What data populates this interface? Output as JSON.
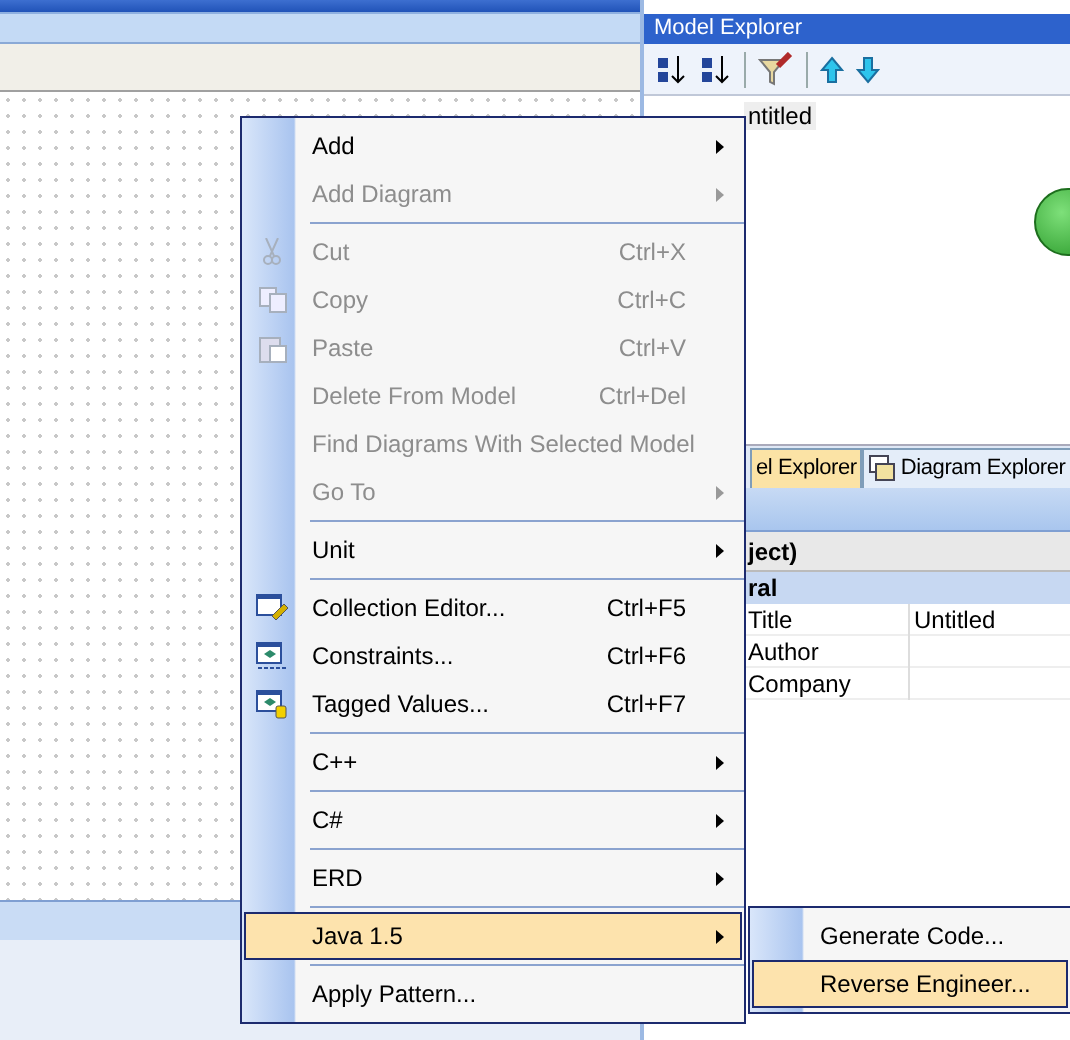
{
  "explorer": {
    "title": "Model Explorer",
    "tree_items": [
      {
        "label": "ntitled",
        "selected": true
      }
    ],
    "tabs": [
      {
        "label": "el Explorer",
        "selected": true
      },
      {
        "label": "Diagram Explorer",
        "selected": false
      }
    ]
  },
  "properties": {
    "object_header": "ject)",
    "group": "ral",
    "rows": [
      {
        "name": "Title",
        "value": "Untitled"
      },
      {
        "name": "Author",
        "value": ""
      },
      {
        "name": "Company",
        "value": ""
      }
    ]
  },
  "context_menu": {
    "items": [
      {
        "kind": "item",
        "label": "Add",
        "disabled": false,
        "submenu": true,
        "selected": false
      },
      {
        "kind": "item",
        "label": "Add Diagram",
        "disabled": true,
        "submenu": true,
        "selected": false
      },
      {
        "kind": "separator"
      },
      {
        "kind": "icon_item",
        "label": "Cut",
        "shortcut": "Ctrl+X",
        "disabled": true,
        "submenu": false,
        "selected": false
      },
      {
        "kind": "icon_item",
        "label": "Copy",
        "shortcut": "Ctrl+C",
        "disabled": true,
        "submenu": false,
        "selected": false
      },
      {
        "kind": "icon_item",
        "label": "Paste",
        "shortcut": "Ctrl+V",
        "disabled": true,
        "submenu": false,
        "selected": false
      },
      {
        "kind": "item",
        "label": "Delete From Model",
        "shortcut": "Ctrl+Del",
        "disabled": true,
        "submenu": false,
        "selected": false
      },
      {
        "kind": "item",
        "label": "Find Diagrams With Selected Model",
        "disabled": true,
        "submenu": false,
        "selected": false
      },
      {
        "kind": "item",
        "label": "Go To",
        "disabled": true,
        "submenu": true,
        "selected": false
      },
      {
        "kind": "separator"
      },
      {
        "kind": "item",
        "label": "Unit",
        "disabled": false,
        "submenu": true,
        "selected": false
      },
      {
        "kind": "separator"
      },
      {
        "kind": "icon_item",
        "label": "Collection Editor...",
        "shortcut": "Ctrl+F5",
        "disabled": false,
        "submenu": false,
        "selected": false
      },
      {
        "kind": "icon_item",
        "label": "Constraints...",
        "shortcut": "Ctrl+F6",
        "disabled": false,
        "submenu": false,
        "selected": false
      },
      {
        "kind": "icon_item",
        "label": "Tagged Values...",
        "shortcut": "Ctrl+F7",
        "disabled": false,
        "submenu": false,
        "selected": false
      },
      {
        "kind": "separator"
      },
      {
        "kind": "item",
        "label": "C++",
        "disabled": false,
        "submenu": true,
        "selected": false
      },
      {
        "kind": "separator"
      },
      {
        "kind": "item",
        "label": "C#",
        "disabled": false,
        "submenu": true,
        "selected": false
      },
      {
        "kind": "separator"
      },
      {
        "kind": "item",
        "label": "ERD",
        "disabled": false,
        "submenu": true,
        "selected": false
      },
      {
        "kind": "separator"
      },
      {
        "kind": "item",
        "label": "Java 1.5",
        "disabled": false,
        "submenu": true,
        "selected": true
      },
      {
        "kind": "separator"
      },
      {
        "kind": "item",
        "label": "Apply Pattern...",
        "disabled": false,
        "submenu": false,
        "selected": false
      }
    ]
  },
  "submenu": {
    "items": [
      {
        "label": "Generate Code...",
        "selected": false
      },
      {
        "label": "Reverse Engineer...",
        "selected": true
      }
    ]
  }
}
